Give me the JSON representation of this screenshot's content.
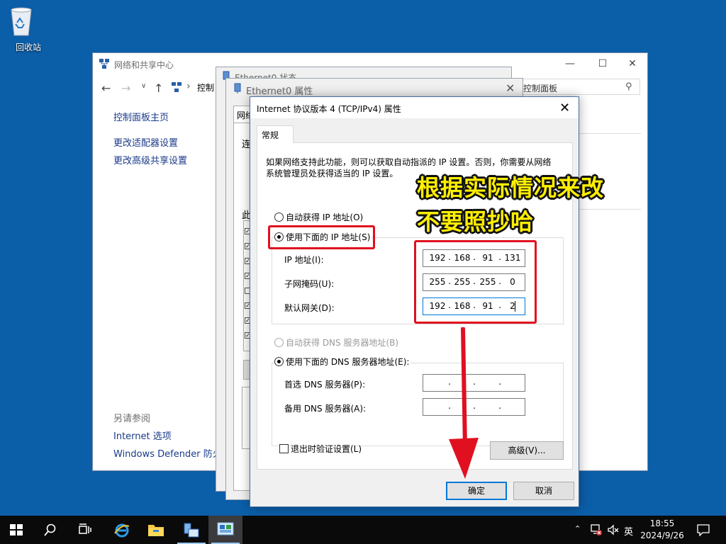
{
  "desktop": {
    "recycle_bin_label": "回收站"
  },
  "network_center": {
    "title": "网络和共享中心",
    "address_crumb": "控制",
    "search_placeholder": "控制面板",
    "side_links": [
      "控制面板主页",
      "更改适配器设置",
      "更改高级共享设置"
    ],
    "see_also_label": "另请参阅",
    "see_also_links": [
      "Internet 选项",
      "Windows Defender 防火"
    ]
  },
  "status_window": {
    "title": "Ethernet0 状态"
  },
  "properties_window": {
    "title": "Ethernet0 属性",
    "tab_fragment": "网络",
    "label_fragment_a": "连",
    "label_fragment_b": "此"
  },
  "ipv4_dialog": {
    "title": "Internet 协议版本 4 (TCP/IPv4) 属性",
    "tab_general": "常规",
    "intro": "如果网络支持此功能，则可以获取自动指派的 IP 设置。否则，你需要从网络系统管理员处获得适当的 IP 设置。",
    "radio_auto_ip": "自动获得 IP 地址(O)",
    "radio_manual_ip": "使用下面的 IP 地址(S)",
    "label_ip": "IP 地址(I):",
    "label_mask": "子网掩码(U):",
    "label_gateway": "默认网关(D):",
    "ip_address": [
      "192",
      "168",
      "91",
      "131"
    ],
    "subnet_mask": [
      "255",
      "255",
      "255",
      "0"
    ],
    "gateway": [
      "192",
      "168",
      "91",
      "2"
    ],
    "radio_auto_dns": "自动获得 DNS 服务器地址(B)",
    "radio_manual_dns": "使用下面的 DNS 服务器地址(E):",
    "label_dns_preferred": "首选 DNS 服务器(P):",
    "label_dns_alternate": "备用 DNS 服务器(A):",
    "dns_preferred": [
      "",
      "",
      "",
      ""
    ],
    "dns_alternate": [
      "",
      "",
      "",
      ""
    ],
    "checkbox_validate": "退出时验证设置(L)",
    "button_advanced": "高级(V)...",
    "button_ok": "确定",
    "button_cancel": "取消"
  },
  "annotation": {
    "line1": "根据实际情况来改",
    "line2": "不要照抄哈",
    "highlight_color": "#e01020",
    "text_color": "#ffef00"
  },
  "taskbar": {
    "ime_indicator": "英",
    "time": "18:55",
    "date": "2024/9/26"
  },
  "colors": {
    "desktop_bg": "#0b5ea8",
    "taskbar_bg": "#0a0a0b",
    "focus_blue": "#0078d7",
    "link_blue": "#1a3a8a"
  }
}
